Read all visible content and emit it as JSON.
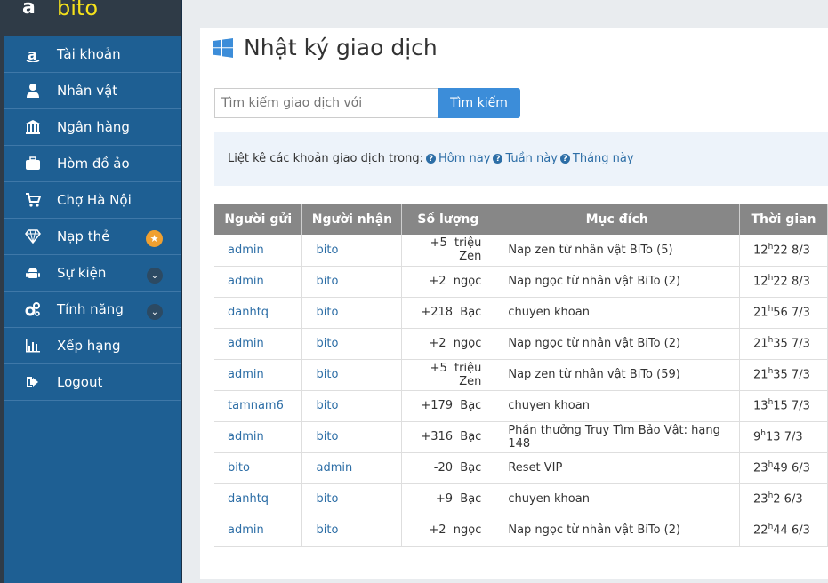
{
  "brand": {
    "logo": "a",
    "name": "bito"
  },
  "sidebar": {
    "items": [
      {
        "label": "Tài khoản",
        "icon": "amazon-icon"
      },
      {
        "label": "Nhân vật",
        "icon": "user-icon"
      },
      {
        "label": "Ngân hàng",
        "icon": "bank-icon"
      },
      {
        "label": "Hòm đồ ảo",
        "icon": "briefcase-icon"
      },
      {
        "label": "Chợ Hà Nội",
        "icon": "cart-icon"
      },
      {
        "label": "Nạp thẻ",
        "icon": "diamond-icon",
        "badge": "★"
      },
      {
        "label": "Sự kiện",
        "icon": "android-icon",
        "chevron": "⌄"
      },
      {
        "label": "Tính năng",
        "icon": "cogs-icon",
        "chevron": "⌄"
      },
      {
        "label": "Xếp hạng",
        "icon": "bar-chart-icon"
      },
      {
        "label": "Logout",
        "icon": "sign-out-icon"
      }
    ]
  },
  "main": {
    "title": "Nhật ký giao dịch",
    "search": {
      "placeholder": "Tìm kiếm giao dịch với",
      "button": "Tìm kiếm"
    },
    "info": {
      "text": "Liệt kê các khoản giao dịch trong:",
      "links": [
        "Hôm nay",
        "Tuần này",
        "Tháng này"
      ]
    },
    "table": {
      "headers": [
        "Người gửi",
        "Người nhận",
        "Số lượng",
        "Mục đích",
        "Thời gian"
      ],
      "rows": [
        {
          "sender": "admin",
          "receiver": "bito",
          "amount": "+5",
          "unit": "triệu Zen",
          "purpose": "Nap zen từ nhân vật BiTo (5)",
          "hour": "12",
          "rest": "22 8/3"
        },
        {
          "sender": "admin",
          "receiver": "bito",
          "amount": "+2",
          "unit": "ngọc",
          "purpose": "Nap ngọc từ nhân vật BiTo (2)",
          "hour": "12",
          "rest": "22 8/3"
        },
        {
          "sender": "danhtq",
          "receiver": "bito",
          "amount": "+218",
          "unit": "Bạc",
          "purpose": "chuyen khoan",
          "hour": "21",
          "rest": "56 7/3"
        },
        {
          "sender": "admin",
          "receiver": "bito",
          "amount": "+2",
          "unit": "ngọc",
          "purpose": "Nap ngọc từ nhân vật BiTo (2)",
          "hour": "21",
          "rest": "35 7/3"
        },
        {
          "sender": "admin",
          "receiver": "bito",
          "amount": "+5",
          "unit": "triệu Zen",
          "purpose": "Nap zen từ nhân vật BiTo (59)",
          "hour": "21",
          "rest": "35 7/3"
        },
        {
          "sender": "tamnam6",
          "receiver": "bito",
          "amount": "+179",
          "unit": "Bạc",
          "purpose": "chuyen khoan",
          "hour": "13",
          "rest": "15 7/3"
        },
        {
          "sender": "admin",
          "receiver": "bito",
          "amount": "+316",
          "unit": "Bạc",
          "purpose": "Phần thưởng Truy Tìm Bảo Vật: hạng 148",
          "hour": "9",
          "rest": "13 7/3"
        },
        {
          "sender": "bito",
          "receiver": "admin",
          "amount": "-20",
          "unit": "Bạc",
          "purpose": "Reset VIP",
          "hour": "23",
          "rest": "49 6/3"
        },
        {
          "sender": "danhtq",
          "receiver": "bito",
          "amount": "+9",
          "unit": "Bạc",
          "purpose": "chuyen khoan",
          "hour": "23",
          "rest": "2 6/3"
        },
        {
          "sender": "admin",
          "receiver": "bito",
          "amount": "+2",
          "unit": "ngọc",
          "purpose": "Nap ngọc từ nhân vật BiTo (2)",
          "hour": "22",
          "rest": "44 6/3"
        }
      ],
      "hour_suffix": "h"
    }
  },
  "colors": {
    "sidebar": "#1e5f93",
    "brand_bg": "#2f3b47",
    "brand_name": "#f6e21b",
    "accent": "#3c8dd9",
    "link": "#2d6ea6",
    "header": "#878787"
  }
}
